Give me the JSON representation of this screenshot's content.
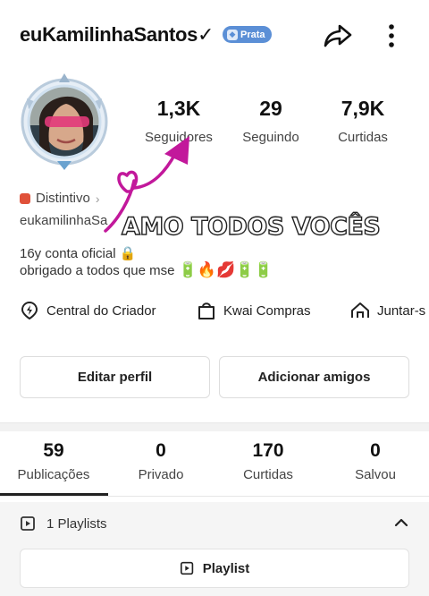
{
  "header": {
    "username": "euKamilinhaSantos✓",
    "badge_label": "Prata",
    "badge_color": "#5b8fd6"
  },
  "stats": [
    {
      "value": "1,3K",
      "label": "Seguidores"
    },
    {
      "value": "29",
      "label": "Seguindo"
    },
    {
      "value": "7,9K",
      "label": "Curtidas"
    }
  ],
  "profile": {
    "distintivo_label": "Distintivo",
    "handle": "eukamilinhaSa",
    "overlay_text": "AMO TODOS VOCÊS",
    "bio_line1": "16y conta oficial 🔒",
    "bio_line2_prefix": "obrigado a todos que m",
    "bio_line2_mid": "se",
    "bio_emojis": "🔋🔥💋🔋🔋"
  },
  "links": [
    {
      "label": "Central do Criador",
      "icon": "creator-center-icon"
    },
    {
      "label": "Kwai Compras",
      "icon": "shopping-bag-icon"
    },
    {
      "label": "Juntar-s",
      "icon": "house-icon"
    }
  ],
  "actions": {
    "edit_profile": "Editar perfil",
    "add_friends": "Adicionar amigos"
  },
  "tabs": [
    {
      "count": "59",
      "label": "Publicações",
      "active": true
    },
    {
      "count": "0",
      "label": "Privado"
    },
    {
      "count": "170",
      "label": "Curtidas"
    },
    {
      "count": "0",
      "label": "Salvou"
    }
  ],
  "playlists": {
    "header": "1 Playlists",
    "button": "Playlist"
  },
  "colors": {
    "annotation_magenta": "#c2189b",
    "accent_dark": "#222222"
  }
}
